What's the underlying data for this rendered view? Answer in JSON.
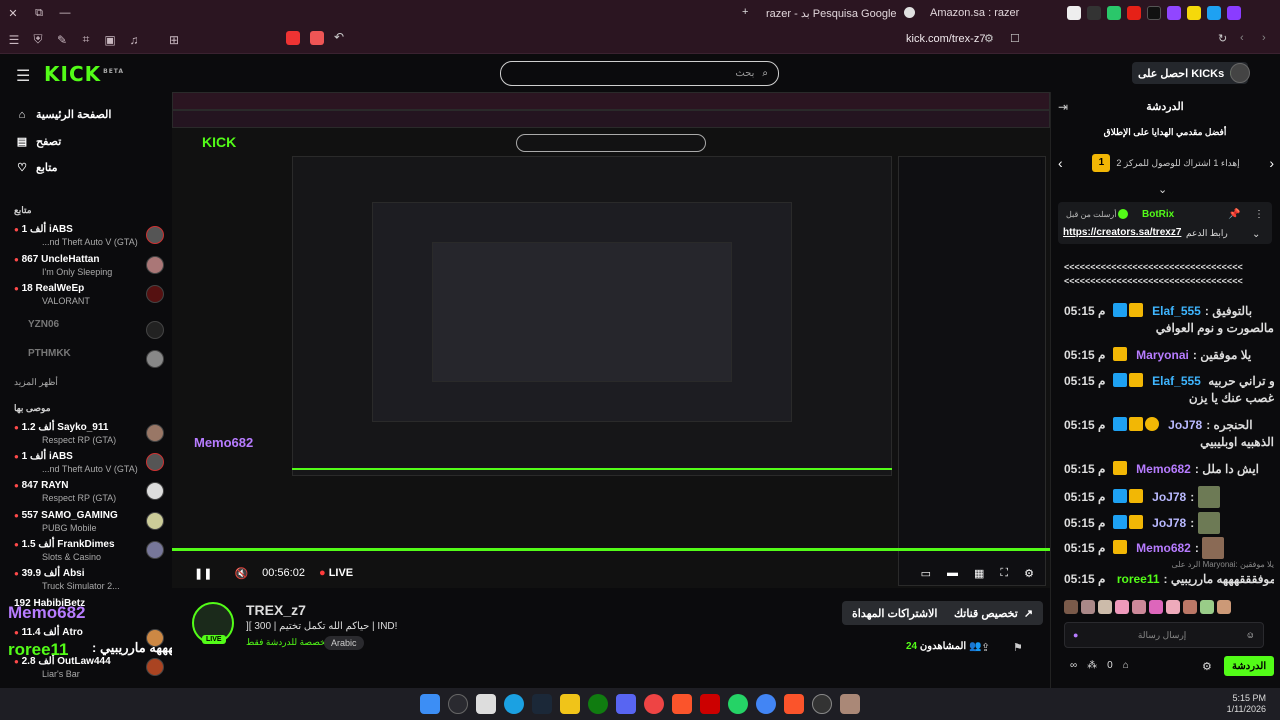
{
  "browser": {
    "tabs": [
      {
        "label": "razer - بد Pesquisa Google"
      },
      {
        "label": "Amazon.sa : razer"
      }
    ],
    "url": "kick.com/trex-z7"
  },
  "header": {
    "logo": "KICK",
    "logo_sup": "BETA",
    "search_placeholder": "بحث",
    "get_kicks": "احصل على KICKs"
  },
  "sidebar": {
    "nav": [
      {
        "label": "الصفحة الرئيسية",
        "icon": "home-icon"
      },
      {
        "label": "تصفح",
        "icon": "browse-icon"
      },
      {
        "label": "متابع",
        "icon": "heart-icon"
      }
    ],
    "following_title": "متابع",
    "following": [
      {
        "name": "iABS",
        "count": "1 ألف",
        "game": "...nd Theft Auto V (GTA)"
      },
      {
        "name": "UncleHattan",
        "count": "867",
        "game": "I'm Only Sleeping"
      },
      {
        "name": "RealWeEp",
        "count": "18",
        "game": "VALORANT"
      },
      {
        "name": "YZN06",
        "count": "",
        "game": ""
      },
      {
        "name": "PTHMKK",
        "count": "",
        "game": ""
      }
    ],
    "show_more": "أظهر المزيد",
    "recommended_title": "موصى بها",
    "recommended": [
      {
        "name": "Sayko_911",
        "count": "1.2 ألف",
        "game": "Respect RP (GTA)"
      },
      {
        "name": "iABS",
        "count": "1 ألف",
        "game": "...nd Theft Auto V (GTA)"
      },
      {
        "name": "RAYN",
        "count": "847",
        "game": "Respect RP (GTA)"
      },
      {
        "name": "SAMO_GAMING",
        "count": "557",
        "game": "PUBG Mobile"
      },
      {
        "name": "FrankDimes",
        "count": "1.5 ألف",
        "game": "Slots & Casino"
      },
      {
        "name": "Absi",
        "count": "39.9 ألف",
        "game": "Truck Simulator 2..."
      },
      {
        "name": "HabibiBetz",
        "count": "192",
        "game": ""
      },
      {
        "name": "Atro",
        "count": "11.4 ألف",
        "game": ""
      },
      {
        "name": "OutLaw444",
        "count": "2.8 ألف",
        "game": "Liar's Bar"
      }
    ]
  },
  "player": {
    "time": "00:56:02",
    "live": "LIVE",
    "overlay_user": "Memo682",
    "overlay_user2": "roree11",
    "overlay_text": "موفقققهههه مارريبيي :"
  },
  "stream": {
    "streamer": "TREX_z7",
    "title": "][ حياكم الله تكمل تختيم | 300 | IND!",
    "category": "مخصصة للدردشة فقط",
    "tag": "Arabic",
    "gift_subs": "الاشتراكات المهداة",
    "customize": "تخصيص قناتك",
    "viewers_label": "المشاهدون",
    "viewers": "24"
  },
  "chat": {
    "title": "الدردشة",
    "top_gifters": "أفضل مقدمي الهدايا على الإطلاق",
    "gifter_text": "إهداء 1 اشتراك للوصول للمركز 2",
    "gifter_rank": "1",
    "pinned_user": "BotRix",
    "pinned_by": "أرسلت من قبل",
    "pinned_link": "https://creators.sa/trexz7",
    "pinned_label": "رابط الدعم",
    "divider": "<<<<<<<<<<<<<<<<<<<<<<<<<<<<<<<<<<",
    "messages": [
      {
        "time": "05:15 م",
        "user": "Elaf_555",
        "text": "بالتوفيق",
        "color": "#3fb6ff"
      },
      {
        "time": "",
        "user": "",
        "text": "مالصورت و نوم العوافي",
        "color": "#ddd"
      },
      {
        "time": "05:15 م",
        "user": "Maryonai",
        "text": "يلا موفقين",
        "color": "#b77cff"
      },
      {
        "time": "05:15 م",
        "user": "Elaf_555",
        "text": "و تراني حربيه",
        "color": "#3fb6ff"
      },
      {
        "time": "",
        "user": "",
        "text": "غصب عنك يا يزن",
        "color": "#ddd"
      },
      {
        "time": "05:15 م",
        "user": "JoJ78",
        "text": "الحنجره",
        "color": "#b9b9ff"
      },
      {
        "time": "",
        "user": "",
        "text": "الذهبيه اوبليبيي",
        "color": "#ddd"
      },
      {
        "time": "05:15 م",
        "user": "Memo682",
        "text": "ايش دا ملل",
        "color": "#b77cff"
      },
      {
        "time": "05:15 م",
        "user": "JoJ78",
        "text": "",
        "color": "#b9b9ff"
      },
      {
        "time": "05:15 م",
        "user": "JoJ78",
        "text": "",
        "color": "#b9b9ff"
      },
      {
        "time": "05:15 م",
        "user": "Memo682",
        "text": "",
        "color": "#b77cff"
      }
    ],
    "reply_to": "الرد على Maryonai: يلا موفقين",
    "last_msg": {
      "time": "05:15 م",
      "user": "roree11",
      "text": "موفقققهههه مارريبيي",
      "color": "#53fc18"
    },
    "input_placeholder": "إرسال رسالة",
    "send": "الدردشة",
    "kicks_count": "0"
  },
  "taskbar": {
    "time": "5:15 PM",
    "date": "1/11/2026"
  }
}
